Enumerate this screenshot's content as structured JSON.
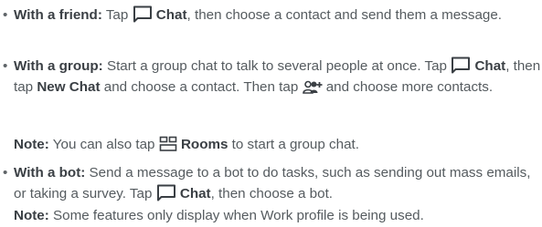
{
  "items": [
    {
      "bullet": "•",
      "lead": "With a friend:",
      "t1": " Tap ",
      "chat": "Chat",
      "t2": ", then choose a contact and send them a message."
    },
    {
      "bullet": "•",
      "lead": "With a group:",
      "t1": " Start a group chat to talk to several people at once. Tap ",
      "chat": "Chat",
      "t2": ", then tap ",
      "newchat": "New Chat",
      "t3": " and choose a contact. Then tap ",
      "t4": " and choose more contacts."
    },
    {
      "bullet": "•",
      "lead": "With a bot:",
      "t1": " Send a message to a bot to do tasks, such as sending out mass emails, or taking a survey. Tap ",
      "chat": "Chat",
      "t2": ", then choose a bot."
    }
  ],
  "notes": [
    {
      "label": "Note:",
      "t1": " You can also tap ",
      "rooms": "Rooms",
      "t2": " to start a group chat."
    },
    {
      "label": "Note:",
      "t1": " Some features only display when Work profile is being used."
    }
  ],
  "icons": {
    "chat": "chat-bubble-icon",
    "add_people": "add-people-icon",
    "rooms": "rooms-grid-icon"
  }
}
